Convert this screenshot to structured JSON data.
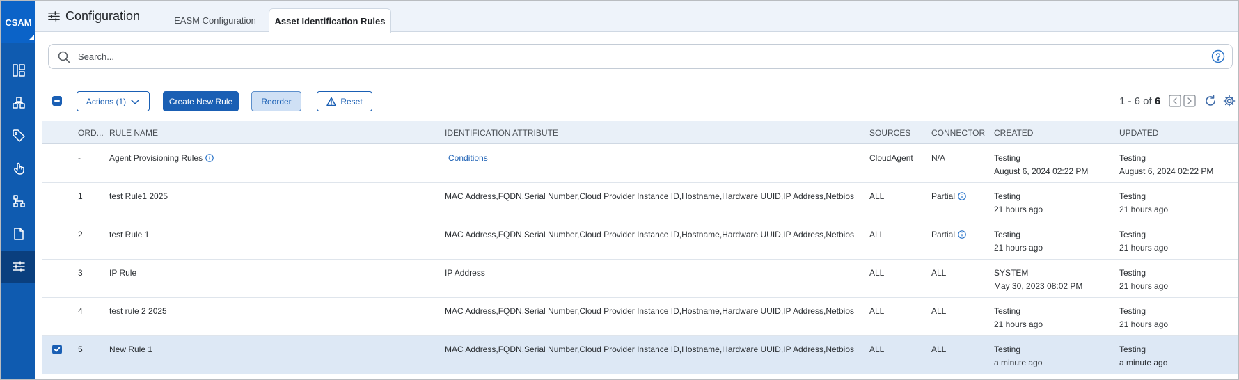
{
  "brand": {
    "name": "CSAM"
  },
  "sidebar": {
    "items": [
      {
        "icon": "dashboard-icon",
        "active": false
      },
      {
        "icon": "inventory-icon",
        "active": false
      },
      {
        "icon": "tag-icon",
        "active": false
      },
      {
        "icon": "touch-icon",
        "active": false
      },
      {
        "icon": "network-icon",
        "active": false
      },
      {
        "icon": "document-icon",
        "active": false
      },
      {
        "icon": "sliders-icon",
        "active": true
      }
    ]
  },
  "header": {
    "title": "Configuration",
    "tabs": [
      {
        "label": "EASM Configuration",
        "active": false
      },
      {
        "label": "Asset Identification Rules",
        "active": true
      }
    ]
  },
  "search": {
    "placeholder": "Search...",
    "value": ""
  },
  "toolbar": {
    "actions_label": "Actions (1)",
    "create_label": "Create New Rule",
    "reorder_label": "Reorder",
    "reset_label": "Reset"
  },
  "pagination": {
    "range": "1 - 6 of",
    "total": "6"
  },
  "table": {
    "columns": {
      "order": "ORD...",
      "rule_name": "RULE NAME",
      "identification_attribute": "IDENTIFICATION ATTRIBUTE",
      "sources": "SOURCES",
      "connector": "CONNECTOR",
      "created": "CREATED",
      "updated": "UPDATED"
    },
    "rows": [
      {
        "order": "-",
        "rule_name": "Agent Provisioning Rules",
        "attribute": "Conditions",
        "sources": "CloudAgent",
        "connector": "N/A",
        "created_by": "Testing",
        "created_at": "August 6, 2024 02:22 PM",
        "updated_by": "Testing",
        "updated_at": "August 6, 2024 02:22 PM"
      },
      {
        "order": "1",
        "rule_name": "test Rule1 2025",
        "attribute": "MAC Address,FQDN,Serial Number,Cloud Provider Instance ID,Hostname,Hardware UUID,IP Address,Netbios",
        "sources": "ALL",
        "connector": "Partial",
        "created_by": "Testing",
        "created_at": "21 hours ago",
        "updated_by": "Testing",
        "updated_at": "21 hours ago"
      },
      {
        "order": "2",
        "rule_name": "test Rule 1",
        "attribute": "MAC Address,FQDN,Serial Number,Cloud Provider Instance ID,Hostname,Hardware UUID,IP Address,Netbios",
        "sources": "ALL",
        "connector": "Partial",
        "created_by": "Testing",
        "created_at": "21 hours ago",
        "updated_by": "Testing",
        "updated_at": "21 hours ago"
      },
      {
        "order": "3",
        "rule_name": "IP Rule",
        "attribute": "IP Address",
        "sources": "ALL",
        "connector": "ALL",
        "created_by": "SYSTEM",
        "created_at": "May 30, 2023 08:02 PM",
        "updated_by": "Testing",
        "updated_at": "21 hours ago"
      },
      {
        "order": "4",
        "rule_name": "test rule 2 2025",
        "attribute": "MAC Address,FQDN,Serial Number,Cloud Provider Instance ID,Hostname,Hardware UUID,IP Address,Netbios",
        "sources": "ALL",
        "connector": "ALL",
        "created_by": "Testing",
        "created_at": "21 hours ago",
        "updated_by": "Testing",
        "updated_at": "21 hours ago"
      },
      {
        "order": "5",
        "rule_name": "New Rule 1",
        "attribute": "MAC Address,FQDN,Serial Number,Cloud Provider Instance ID,Hostname,Hardware UUID,IP Address,Netbios",
        "sources": "ALL",
        "connector": "ALL",
        "created_by": "Testing",
        "created_at": "a minute ago",
        "updated_by": "Testing",
        "updated_at": "a minute ago",
        "selected": true
      }
    ]
  },
  "colors": {
    "sidebar": "#0f5bb0",
    "brand": "#0b63c8",
    "accent": "#1a5fb4",
    "selected_row": "#dde8f5",
    "header_bg": "#eef3fa"
  }
}
